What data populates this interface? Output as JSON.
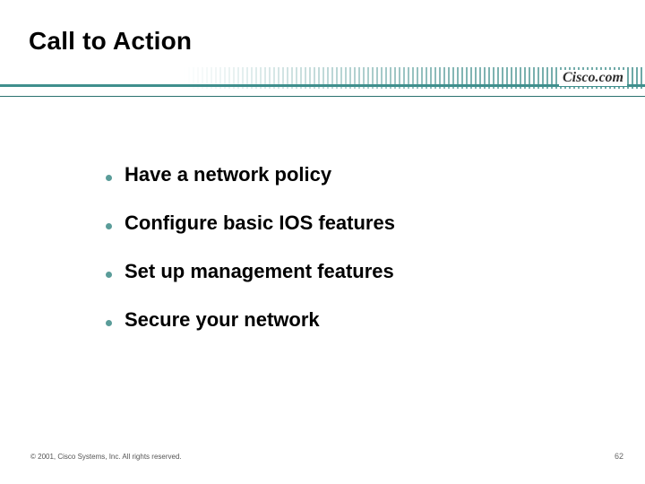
{
  "title": "Call to Action",
  "brand": "Cisco.com",
  "bullets": [
    "Have a network policy",
    "Configure basic IOS features",
    "Set up management features",
    "Secure your network"
  ],
  "footer": {
    "copyright": "© 2001, Cisco Systems, Inc. All rights reserved.",
    "page": "62"
  },
  "colors": {
    "accent": "#5a9c99"
  }
}
